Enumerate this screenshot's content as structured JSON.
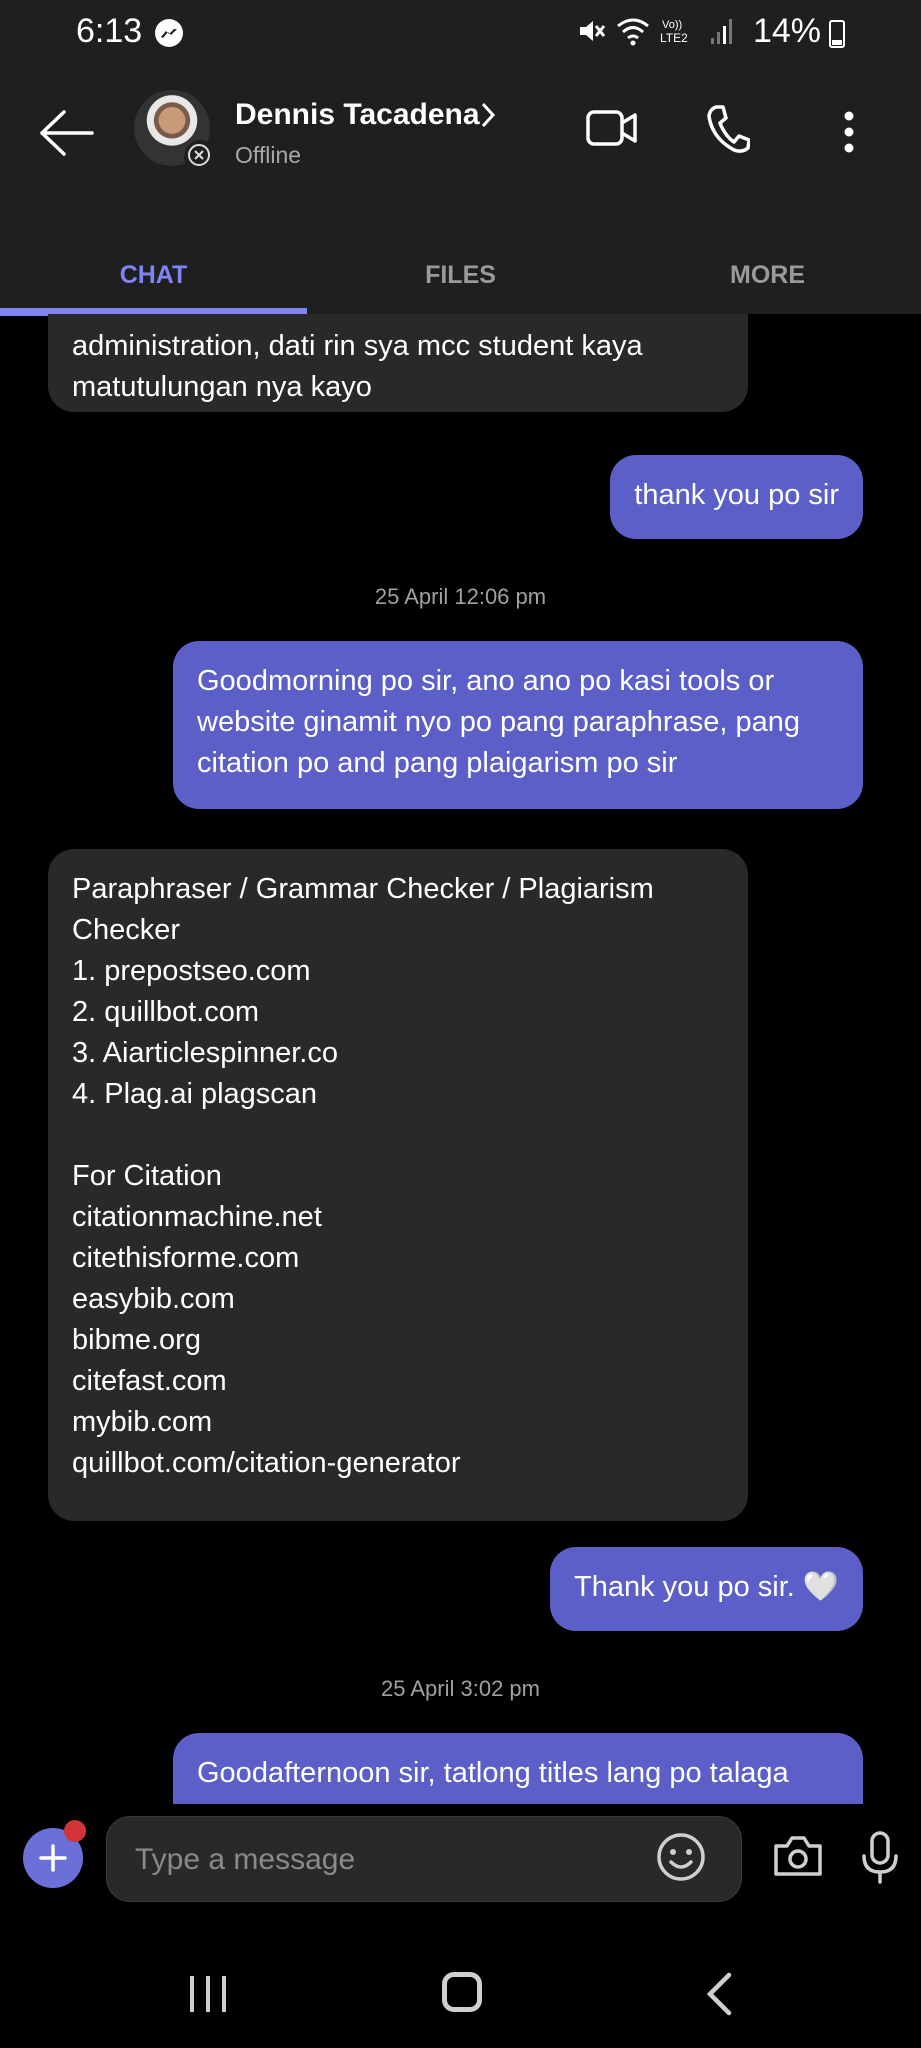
{
  "status_bar": {
    "time": "6:13",
    "battery": "14%"
  },
  "header": {
    "contact_name": "Dennis Tacadena",
    "presence": "Offline",
    "tabs": [
      {
        "label": "CHAT",
        "active": true
      },
      {
        "label": "FILES",
        "active": false
      },
      {
        "label": "MORE",
        "active": false
      }
    ]
  },
  "messages": {
    "m1": {
      "direction": "incoming",
      "lines": [
        "administration, dati rin sya mcc student kaya",
        "matutulungan nya kayo"
      ]
    },
    "m2": {
      "direction": "outgoing",
      "lines": [
        "thank you po sir"
      ]
    },
    "ts1": "25 April 12:06 pm",
    "m3": {
      "direction": "outgoing",
      "lines": [
        "Goodmorning po sir, ano ano po kasi tools or",
        "website ginamit nyo po pang paraphrase, pang",
        "citation po and pang plaigarism po sir"
      ]
    },
    "m4": {
      "direction": "incoming",
      "lines": [
        "Paraphraser / Grammar Checker / Plagiarism",
        "Checker",
        "1. prepostseo.com",
        "2. quillbot.com",
        "3. Aiarticlespinner.co",
        "4. Plag.ai plagscan",
        "",
        "For Citation",
        "citationmachine.net",
        "citethisforme.com",
        "easybib.com",
        "bibme.org",
        "citefast.com",
        "mybib.com",
        "quillbot.com/citation-generator"
      ]
    },
    "m5": {
      "direction": "outgoing",
      "lines": [
        "Thank you po sir. 🤍"
      ]
    },
    "ts2": "25 April 3:02 pm",
    "m6": {
      "direction": "outgoing",
      "lines": [
        "Goodafternoon sir, tatlong titles lang po talaga"
      ]
    }
  },
  "compose": {
    "placeholder": "Type a message"
  },
  "colors": {
    "accent": "#7f85f5",
    "outgoing_bubble": "#5b5fc7",
    "incoming_bubble": "#292929",
    "background": "#000000",
    "header": "#1f1f1f",
    "notification_dot": "#d13438"
  }
}
